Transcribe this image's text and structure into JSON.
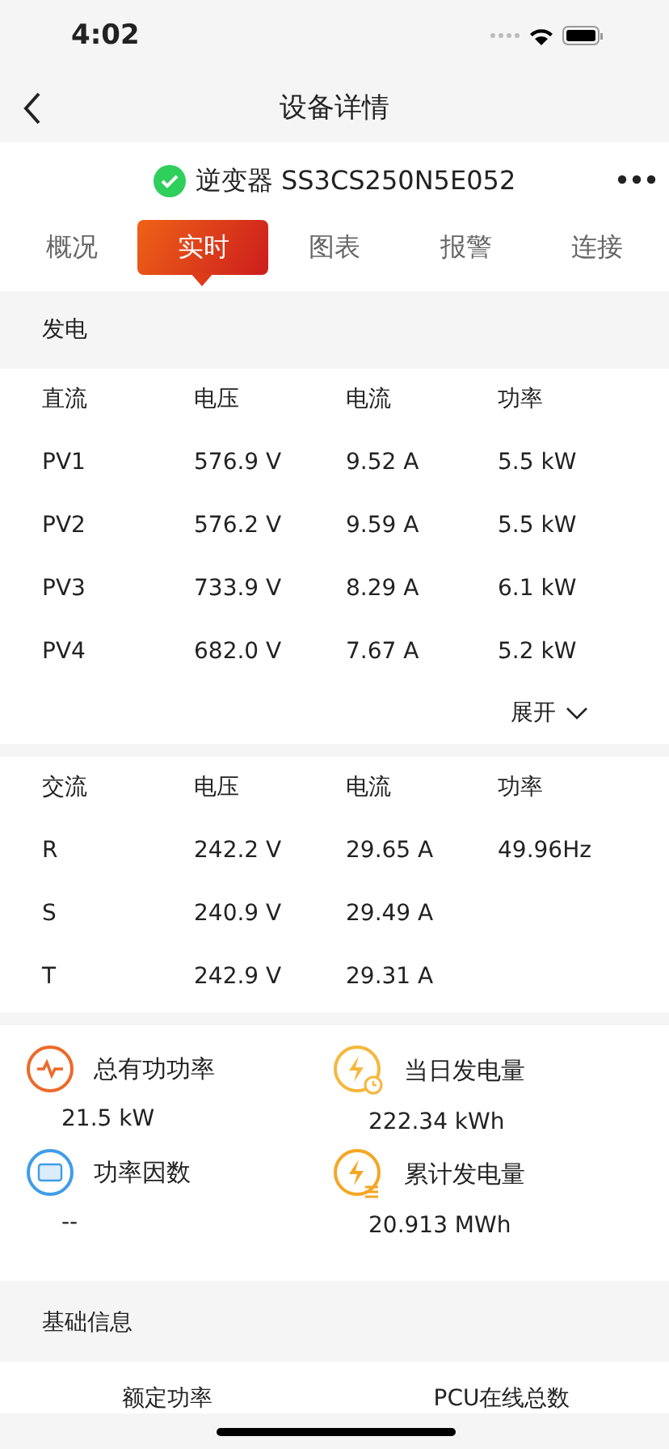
{
  "status_bar": {
    "time": "4:02"
  },
  "nav": {
    "title": "设备详情"
  },
  "device": {
    "online": true,
    "name": "逆变器 SS3CS250N5E052"
  },
  "tabs": [
    {
      "label": "概况",
      "selected": false
    },
    {
      "label": "实时",
      "selected": true
    },
    {
      "label": "图表",
      "selected": false
    },
    {
      "label": "报警",
      "selected": false
    },
    {
      "label": "连接",
      "selected": false
    }
  ],
  "generation": {
    "title": "发电",
    "dc_table": {
      "columns": [
        "直流",
        "电压",
        "电流",
        "功率"
      ],
      "rows": [
        [
          "PV1",
          "576.9 V",
          "9.52 A",
          "5.5 kW"
        ],
        [
          "PV2",
          "576.2 V",
          "9.59 A",
          "5.5 kW"
        ],
        [
          "PV3",
          "733.9 V",
          "8.29 A",
          "6.1 kW"
        ],
        [
          "PV4",
          "682.0 V",
          "7.67 A",
          "5.2 kW"
        ]
      ]
    },
    "expand": {
      "label": "展开",
      "expanded": false
    },
    "ac_table": {
      "columns": [
        "交流",
        "电压",
        "电流",
        "功率"
      ],
      "rows": [
        [
          "R",
          "242.2 V",
          "29.65 A",
          "49.96Hz"
        ],
        [
          "S",
          "240.9 V",
          "29.49 A"
        ],
        [
          "T",
          "242.9 V",
          "29.31 A"
        ]
      ]
    }
  },
  "stats": [
    {
      "kind": "active_power",
      "label": "总有功功率",
      "value": "21.5 kW"
    },
    {
      "kind": "daily_energy",
      "label": "当日发电量",
      "value": "222.34 kWh"
    },
    {
      "kind": "power_factor",
      "label": "功率因数",
      "value": "--"
    },
    {
      "kind": "total_energy",
      "label": "累计发电量",
      "value": "20.913 MWh"
    }
  ],
  "basic_info": {
    "title": "基础信息",
    "items": [
      {
        "label": "额定功率"
      },
      {
        "label": "PCU在线总数"
      }
    ]
  }
}
